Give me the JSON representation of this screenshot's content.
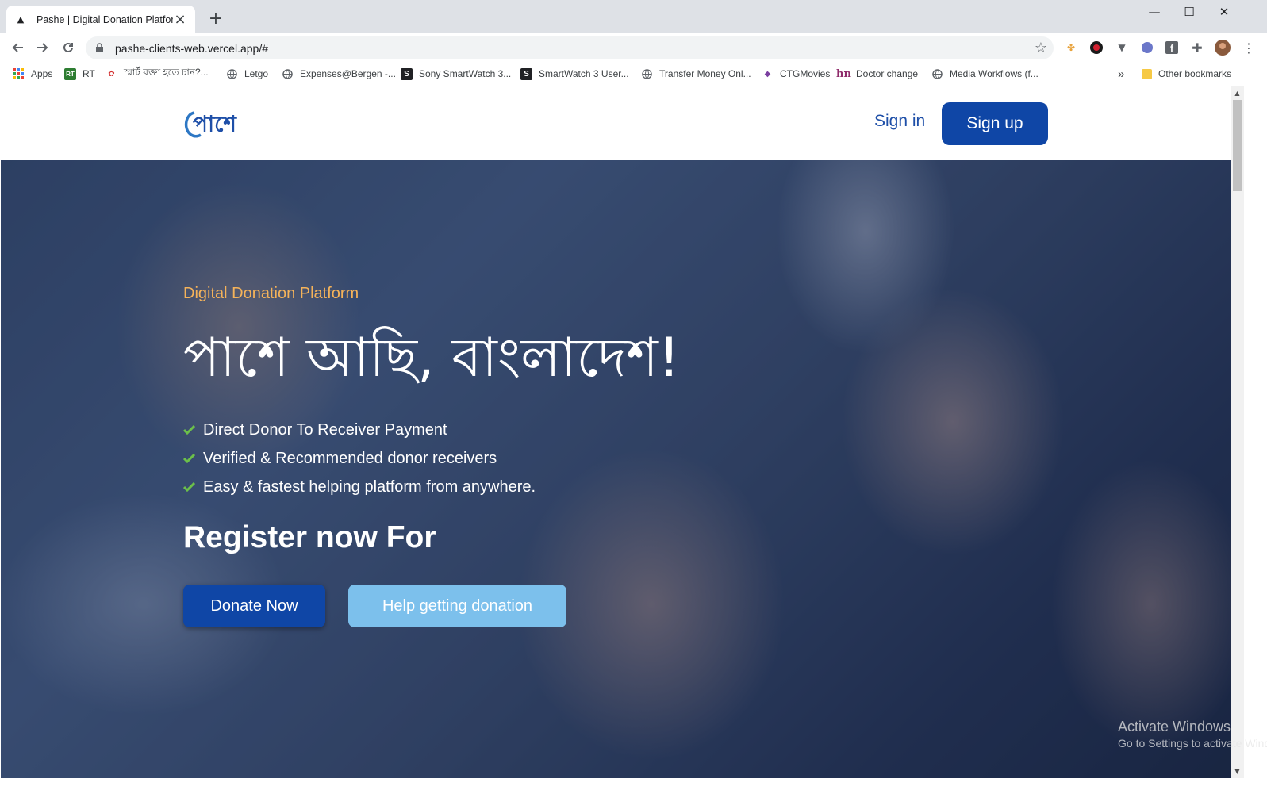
{
  "browser": {
    "tab_title": "Pashe | Digital Donation Platform",
    "new_tab_symbol": "+",
    "url": "pashe-clients-web.vercel.app/#",
    "window_controls": {
      "minimize": "—",
      "maximize": "☐",
      "close": "✕"
    }
  },
  "bookmarks": [
    {
      "label": "Apps",
      "icon": "apps-grid-icon"
    },
    {
      "label": "RT",
      "icon": "rt-icon"
    },
    {
      "label": "স্মার্ট বক্তা হতে চান?...",
      "icon": "bookmark-icon"
    },
    {
      "label": "Letgo",
      "icon": "globe-icon"
    },
    {
      "label": "Expenses@Bergen -...",
      "icon": "globe-icon"
    },
    {
      "label": "Sony SmartWatch 3...",
      "icon": "s-icon"
    },
    {
      "label": "SmartWatch 3 User...",
      "icon": "s-icon"
    },
    {
      "label": "Transfer Money Onl...",
      "icon": "globe-icon"
    },
    {
      "label": "CTGMovies",
      "icon": "ctg-icon"
    },
    {
      "label": "Doctor change",
      "icon": "hn-icon"
    },
    {
      "label": "Media Workflows (f...",
      "icon": "globe-icon"
    }
  ],
  "bookmarks_overflow": "»",
  "other_bookmarks": "Other bookmarks",
  "site": {
    "logo_text": "পাশে",
    "signin_label": "Sign in",
    "signup_label": "Sign up",
    "eyebrow": "Digital Donation Platform",
    "headline": "পাশে আছি, বাংলাদেশ!",
    "features": [
      "Direct Donor To Receiver Payment",
      "Verified & Recommended donor receivers",
      "Easy & fastest helping platform from anywhere."
    ],
    "register_heading": "Register now For",
    "donate_button": "Donate Now",
    "help_button": "Help getting donation"
  },
  "watermark": {
    "line1": "Activate Windows",
    "line2": "Go to Settings to activate Windows."
  },
  "colors": {
    "brand_blue": "#0f46a6",
    "link_blue": "#1e4fa8",
    "accent_orange": "#f5b35a",
    "light_blue": "#7cc0ec",
    "check_green": "#6cc04a"
  }
}
